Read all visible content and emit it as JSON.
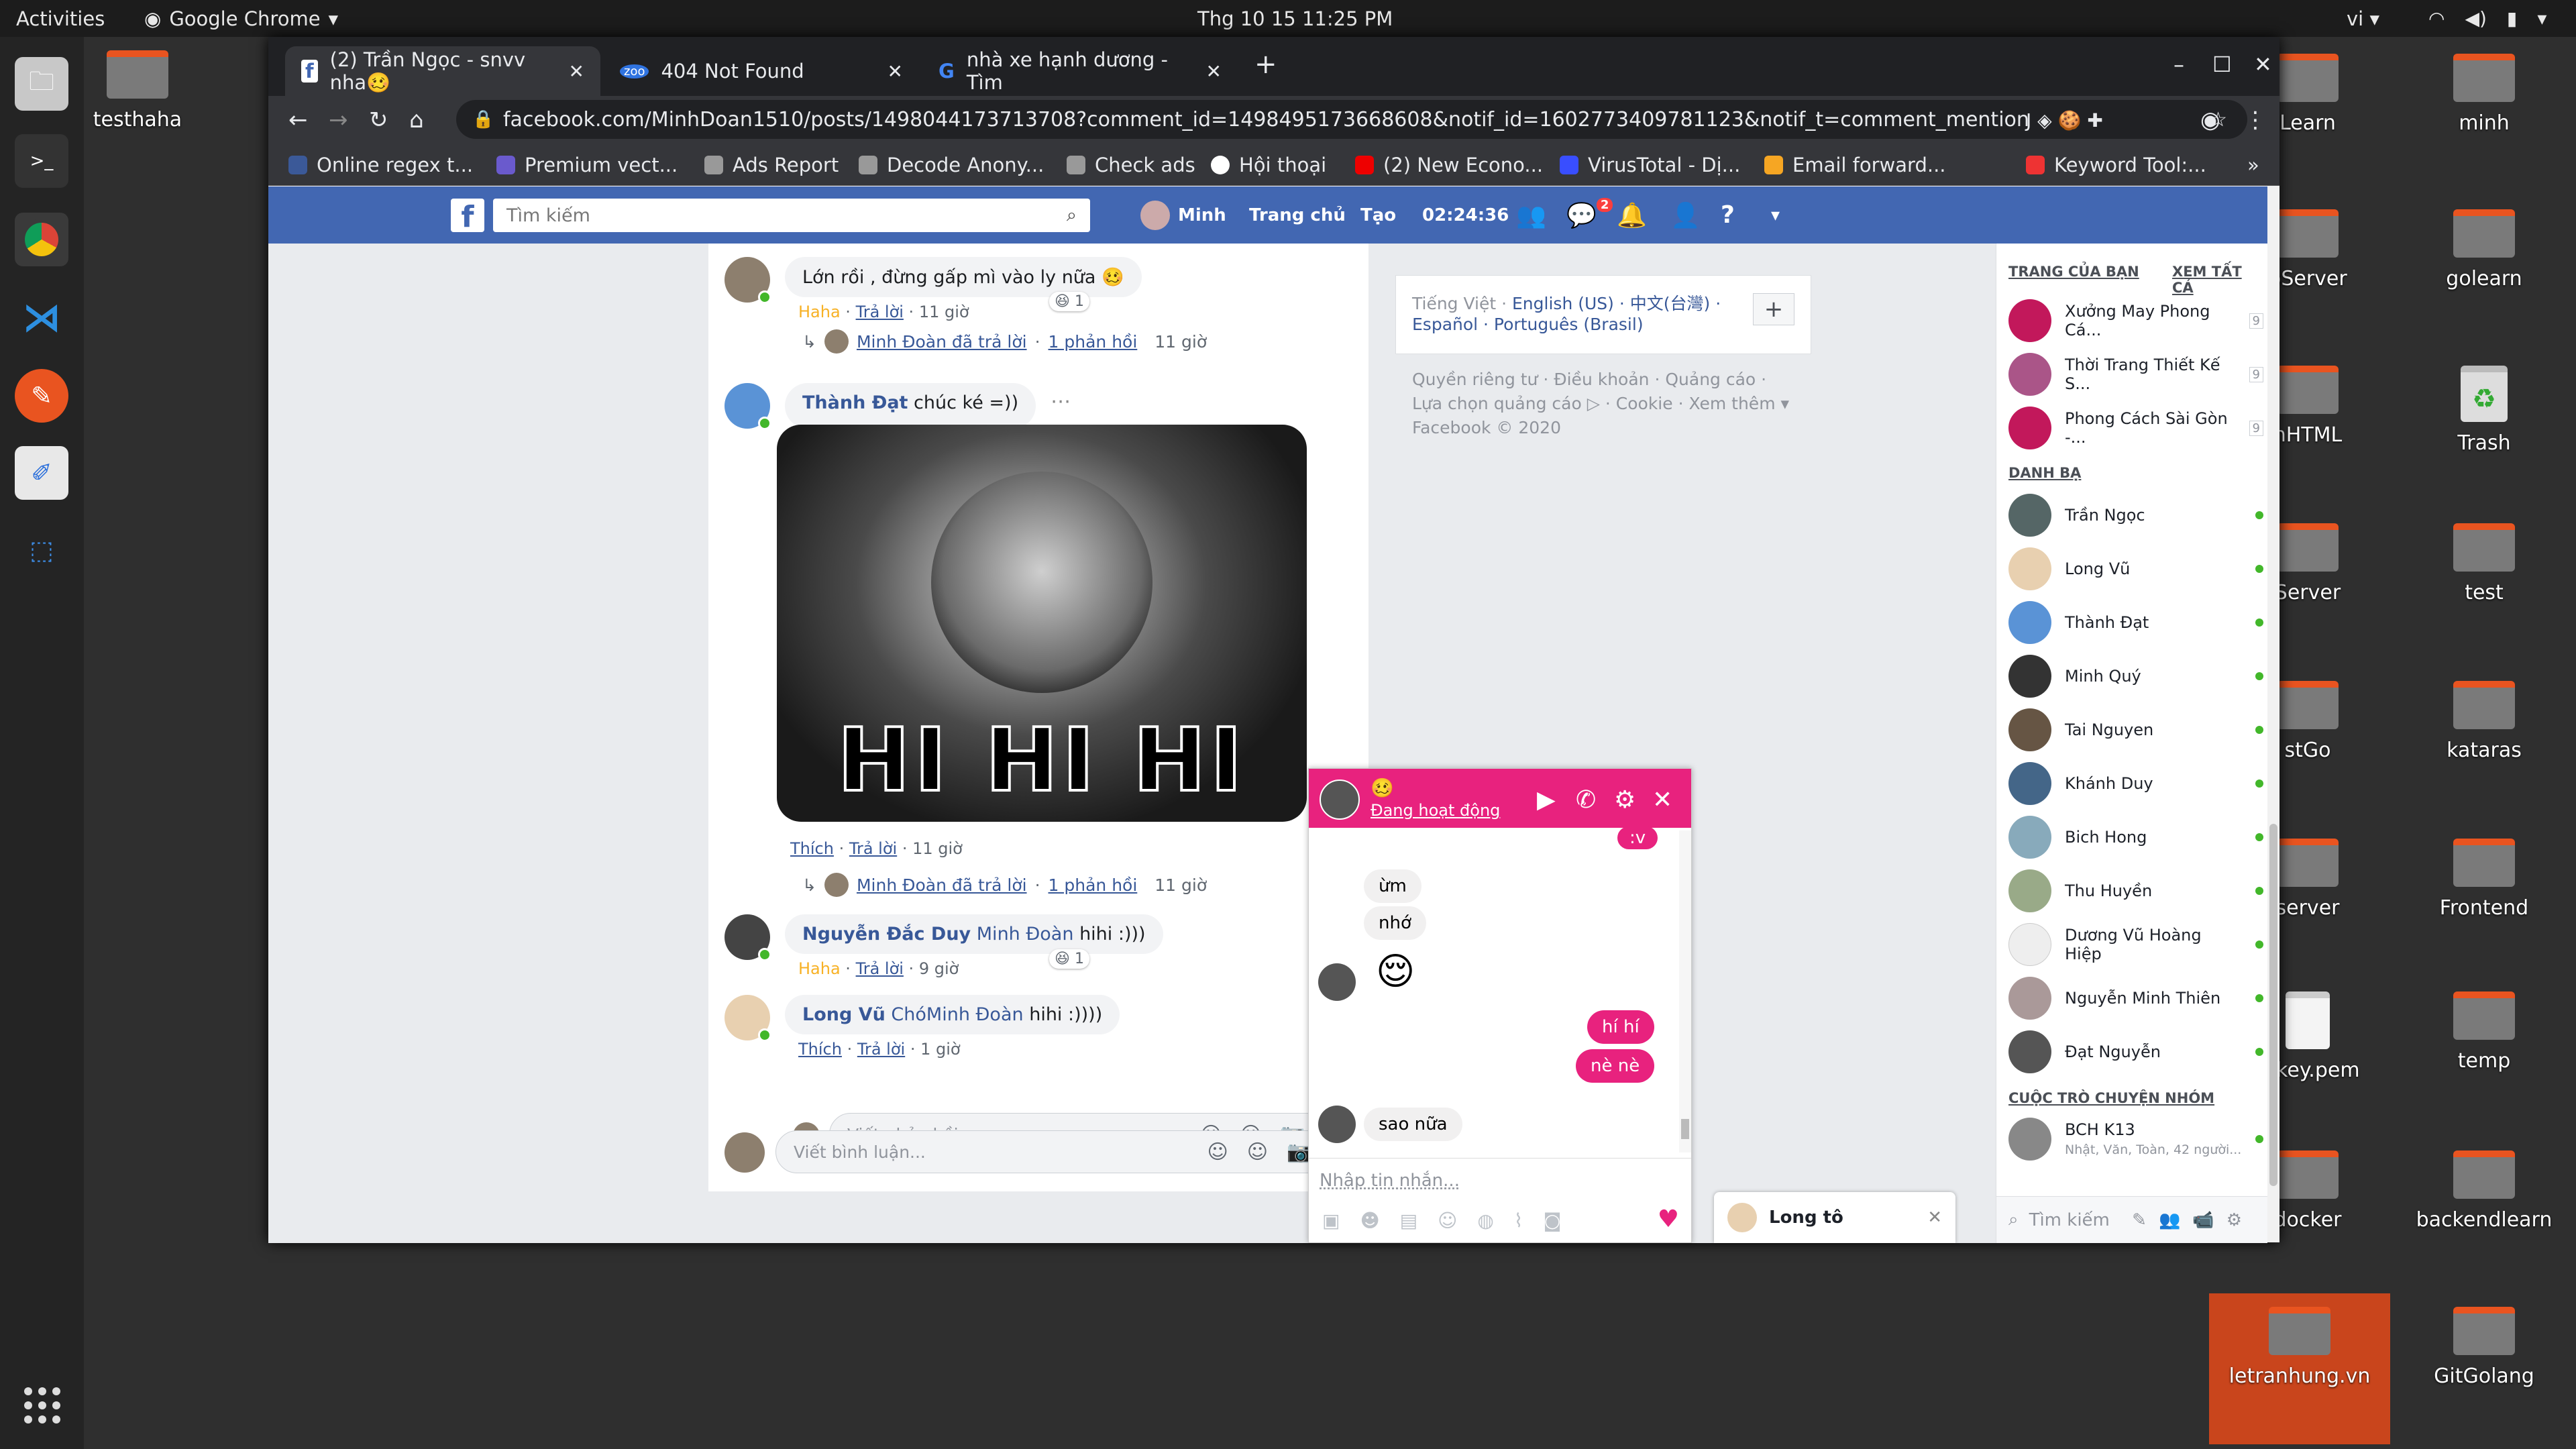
{
  "topbar": {
    "activities": "Activities",
    "app": "Google Chrome",
    "clock": "Thg 10 15  11:25 PM",
    "lang": "vi"
  },
  "desktop": {
    "icons_left": [
      {
        "label": "testhaha"
      }
    ],
    "icons": [
      {
        "label": "Learn"
      },
      {
        "label": "minh"
      },
      {
        "label": "pServer"
      },
      {
        "label": "golearn"
      },
      {
        "label": "hHTML"
      },
      {
        "label": "Trash"
      },
      {
        "label": "Server"
      },
      {
        "label": "test"
      },
      {
        "label": "stGo"
      },
      {
        "label": "kataras"
      },
      {
        "label": "server"
      },
      {
        "label": "Frontend"
      },
      {
        "label": "s_key.pem"
      },
      {
        "label": "temp"
      },
      {
        "label": "docker"
      },
      {
        "label": "backendlearn"
      },
      {
        "label": "letranhung.vn"
      },
      {
        "label": "GitGolang"
      }
    ]
  },
  "browser": {
    "tabs": [
      {
        "title": "(2) Trần Ngọc - snvv nha🥴"
      },
      {
        "title": "404 Not Found"
      },
      {
        "title": "nhà xe hạnh dương - Tìm"
      }
    ],
    "url": "facebook.com/MinhDoan1510/posts/1498044173713708?comment_id=1498495173668608&notif_id=1602773409781123&notif_t=comment_mention",
    "bookmarks": [
      "Online regex t...",
      "Premium vect...",
      "Ads Report",
      "Decode Anony...",
      "Check ads",
      "Hội thoại",
      "(2) New Econo...",
      "VirusTotal - Dị...",
      "Email forward...",
      "Keyword Tool:..."
    ]
  },
  "facebook": {
    "search_placeholder": "Tìm kiếm",
    "nav": {
      "user": "Minh",
      "home": "Trang chủ",
      "create": "Tạo",
      "timer": "02:24:36",
      "messenger_badge": "2"
    },
    "comments": [
      {
        "text": "Lớn rồi , đừng gấp mì vào ly nữa 🥴",
        "reaction": "Haha",
        "reply": "Trả lời",
        "time": "11 giờ",
        "react_count": "1",
        "reply_line": {
          "who": "Minh Đoàn đã trả lời",
          "count": "1 phản hồi",
          "time": "11 giờ"
        }
      },
      {
        "author": "Thành Đạt",
        "text": "chúc ké =))",
        "caption": "HI HI HI",
        "like": "Thích",
        "reply": "Trả lời",
        "time": "11 giờ",
        "reply_line": {
          "who": "Minh Đoàn đã trả lời",
          "count": "1 phản hồi",
          "time": "11 giờ"
        }
      },
      {
        "author": "Nguyễn Đắc Duy",
        "mention": "Minh Đoàn",
        "text": "hihi :)))",
        "reaction": "Haha",
        "reply": "Trả lời",
        "time": "9 giờ",
        "react_count": "1"
      },
      {
        "author": "Long Vũ",
        "mention": "ChóMinh Đoàn",
        "text": "hihi :))))",
        "like": "Thích",
        "reply": "Trả lời",
        "time": "1 giờ"
      }
    ],
    "reply_placeholder": "Viết phản hồi...",
    "comment_placeholder": "Viết bình luận...",
    "langs": {
      "current": "Tiếng Việt",
      "others": "English (US) · 中文(台灣) ·",
      "others2": "Español · Português (Brasil)"
    },
    "footer": [
      "Quyền riêng tư · Điều khoản · Quảng cáo ·",
      "Lựa chọn quảng cáo ▷ · Cookie · Xem thêm ▾",
      "Facebook © 2020"
    ],
    "sidebar": {
      "pages_head": "TRANG CỦA BẠN",
      "see_all": "XEM TẤT CẢ",
      "pages": [
        {
          "name": "Xưởng May Phong Cá...",
          "count": "9"
        },
        {
          "name": "Thời Trang Thiết Kế S...",
          "count": "9"
        },
        {
          "name": "Phong Cách Sài Gòn -...",
          "count": "9"
        }
      ],
      "contacts_head": "DANH BẠ",
      "contacts": [
        "Trần Ngọc",
        "Long Vũ",
        "Thành Đạt",
        "Minh Quý",
        "Tai Nguyen",
        "Khánh Duy",
        "Bich Hong",
        "Thu Huyền",
        "Dương Vũ Hoàng Hiệp",
        "Nguyễn Minh Thiên",
        "Đạt Nguyễn"
      ],
      "groups_head": "CUỘC TRÒ CHUYỆN NHÓM",
      "group": {
        "name": "BCH K13",
        "members": "Nhật, Văn, Toàn, 42 người..."
      },
      "search": "Tìm kiếm"
    },
    "chat": {
      "name": "🥴",
      "status": "Đang hoạt động",
      "messages": [
        {
          "dir": "out",
          "text": ":v"
        },
        {
          "dir": "in",
          "text": "ừm"
        },
        {
          "dir": "in",
          "text": "nhớ"
        },
        {
          "dir": "in",
          "text": "😌"
        },
        {
          "dir": "out",
          "text": "hí hí"
        },
        {
          "dir": "out",
          "text": "nè nè"
        },
        {
          "dir": "in",
          "text": "sao nữa"
        }
      ],
      "placeholder": "Nhập tin nhắn..."
    },
    "mini_chat": "Long tô"
  }
}
